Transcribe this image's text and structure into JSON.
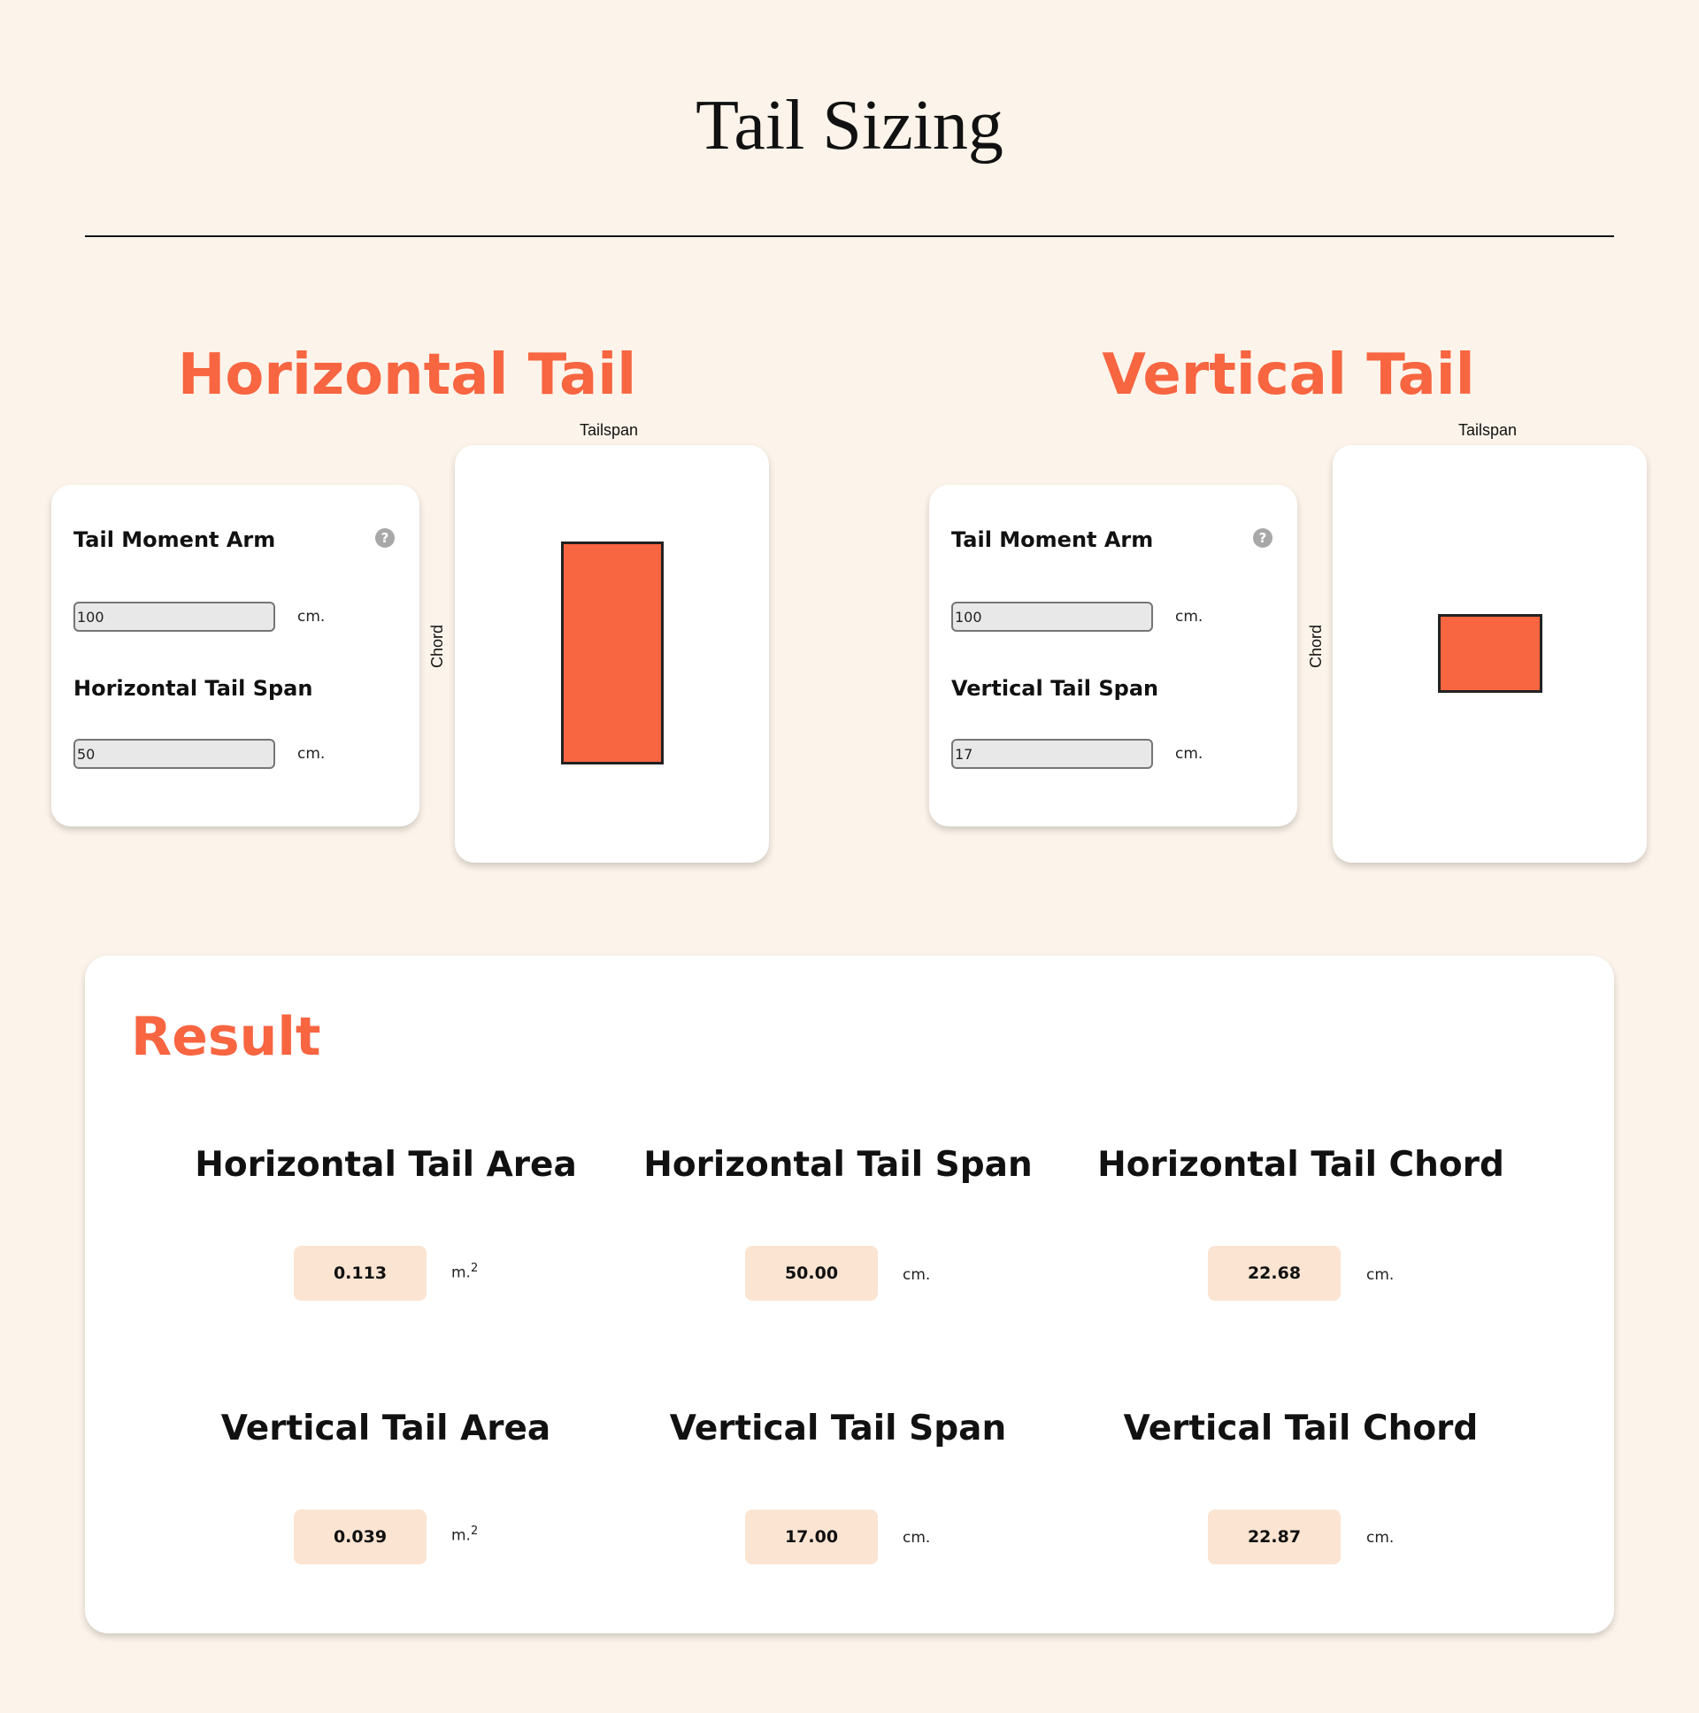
{
  "page": {
    "title": "Tail Sizing"
  },
  "horizontal_tail": {
    "heading": "Horizontal Tail",
    "moment_arm_label": "Tail Moment Arm",
    "moment_arm_help_icon": "question-circle-icon",
    "moment_arm_value": "100",
    "moment_arm_unit": "cm.",
    "span_label": "Horizontal Tail Span",
    "span_value": "50",
    "span_unit": "cm.",
    "diagram_top_label": "Tailspan",
    "diagram_side_label": "Chord",
    "shape_color": "#f76541"
  },
  "vertical_tail": {
    "heading": "Vertical Tail",
    "moment_arm_label": "Tail Moment Arm",
    "moment_arm_help_icon": "question-circle-icon",
    "moment_arm_value": "100",
    "moment_arm_unit": "cm.",
    "span_label": "Vertical Tail Span",
    "span_value": "17",
    "span_unit": "cm.",
    "diagram_top_label": "Tailspan",
    "diagram_side_label": "Chord",
    "shape_color": "#f76541"
  },
  "result": {
    "heading": "Result",
    "items": [
      {
        "label": "Horizontal Tail Area",
        "value": "0.113",
        "unit": "m.",
        "unit_sup": "2"
      },
      {
        "label": "Horizontal Tail Span",
        "value": "50.00",
        "unit": "cm."
      },
      {
        "label": "Horizontal Tail Chord",
        "value": "22.68",
        "unit": "cm."
      },
      {
        "label": "Vertical Tail Area",
        "value": "0.039",
        "unit": "m.",
        "unit_sup": "2"
      },
      {
        "label": "Vertical Tail Span",
        "value": "17.00",
        "unit": "cm."
      },
      {
        "label": "Vertical Tail Chord",
        "value": "22.87",
        "unit": "cm."
      }
    ]
  },
  "colors": {
    "background": "#fcf4ea",
    "accent": "#f76541",
    "value_box": "#fbe4d2"
  }
}
